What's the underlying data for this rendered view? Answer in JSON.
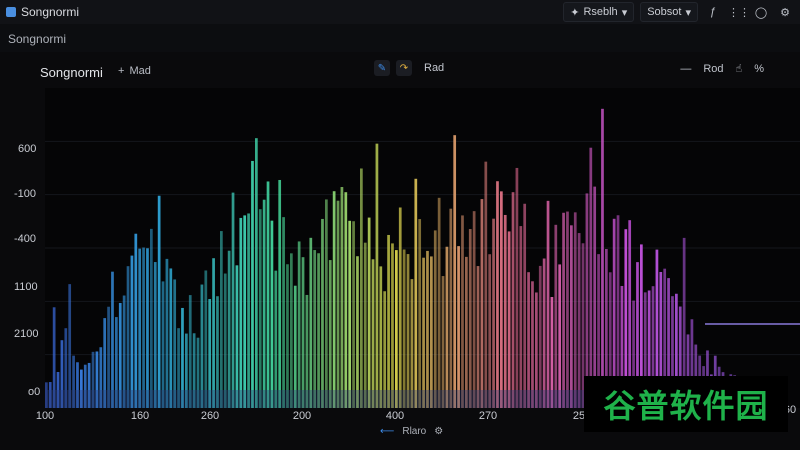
{
  "window": {
    "title": "Songnormi"
  },
  "toolbar": {
    "buttons": [
      {
        "label": "Rseblh",
        "icon": "sparkle-icon"
      },
      {
        "label": "Sobsot",
        "icon": ""
      }
    ],
    "icons": [
      "function-icon",
      "menu-icon",
      "circle-icon",
      "settings-icon"
    ]
  },
  "subtitle": "Songnormi",
  "panel": {
    "title": "Songnormi",
    "add_label": "Mad",
    "center_label": "Rad",
    "right_label": "Rod",
    "percent_label": "%"
  },
  "axes": {
    "y_labels": [
      "600",
      "-100",
      "-400",
      "1100",
      "2100",
      "o0"
    ],
    "x_labels": [
      "100",
      "160",
      "260",
      "200",
      "400",
      "270",
      "25",
      "60"
    ]
  },
  "bottom": {
    "label": "Rlaro"
  },
  "watermark": "谷普软件园",
  "chart_data": {
    "type": "bar",
    "x": [
      "100",
      "160",
      "260",
      "200",
      "400",
      "270",
      "25",
      "60"
    ],
    "ylim": [
      0,
      1
    ],
    "bar_count": 180,
    "colors": [
      "#3a63d8",
      "#2fa7d8",
      "#43d79a",
      "#d7d24a",
      "#e06a8a",
      "#c24fd6",
      "#8a55d8"
    ],
    "envelope": [
      0.1,
      0.14,
      0.2,
      0.3,
      0.45,
      0.6,
      0.55,
      0.4,
      0.35,
      0.5,
      0.72,
      0.86,
      0.78,
      0.62,
      0.55,
      0.7,
      0.82,
      0.74,
      0.6,
      0.66,
      0.76,
      0.7,
      0.62,
      0.74,
      0.88,
      0.8,
      0.66,
      0.58,
      0.72,
      0.84,
      0.76,
      0.62,
      0.54,
      0.48,
      0.32,
      0.2,
      0.14,
      0.1
    ]
  }
}
